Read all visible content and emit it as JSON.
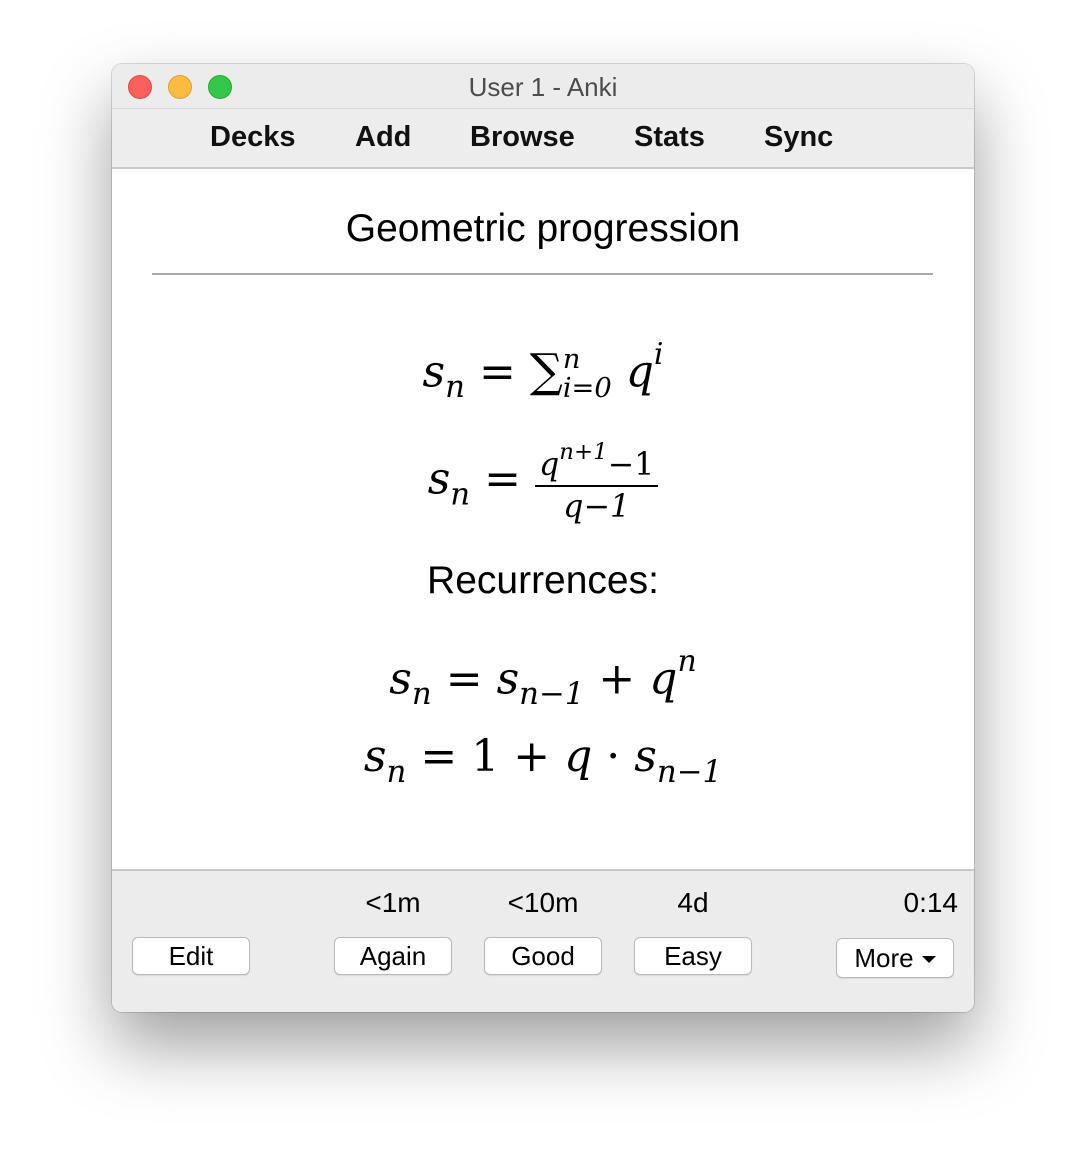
{
  "window": {
    "title": "User 1 - Anki"
  },
  "toolbar": {
    "items": [
      "Decks",
      "Add",
      "Browse",
      "Stats",
      "Sync"
    ]
  },
  "card": {
    "title": "Geometric progression",
    "formula1": {
      "lhs": "s",
      "lhs_sub": "n",
      "eq": "=",
      "sum": "∑",
      "sum_sup": "n",
      "sum_sub": "i=0",
      "base": "q",
      "exp": "i"
    },
    "formula2": {
      "lhs": "s",
      "lhs_sub": "n",
      "eq": "=",
      "num_base": "q",
      "num_exp": "n+1",
      "num_rest": "−1",
      "den": "q−1"
    },
    "recurrences_label": "Recurrences:",
    "formula3": {
      "lhs": "s",
      "lhs_sub": "n",
      "eq": "=",
      "t1": "s",
      "t1_sub": "n−1",
      "plus": "+",
      "t2": "q",
      "t2_exp": "n"
    },
    "formula4": {
      "lhs": "s",
      "lhs_sub": "n",
      "eq": "=",
      "one": "1",
      "plus": "+",
      "q": "q",
      "dot": "·",
      "t": "s",
      "t_sub": "n−1"
    }
  },
  "answer_bar": {
    "intervals": {
      "again": "<1m",
      "good": "<10m",
      "easy": "4d"
    },
    "timer": "0:14",
    "edit_label": "Edit",
    "again_label": "Again",
    "good_label": "Good",
    "easy_label": "Easy",
    "more_label": "More"
  }
}
